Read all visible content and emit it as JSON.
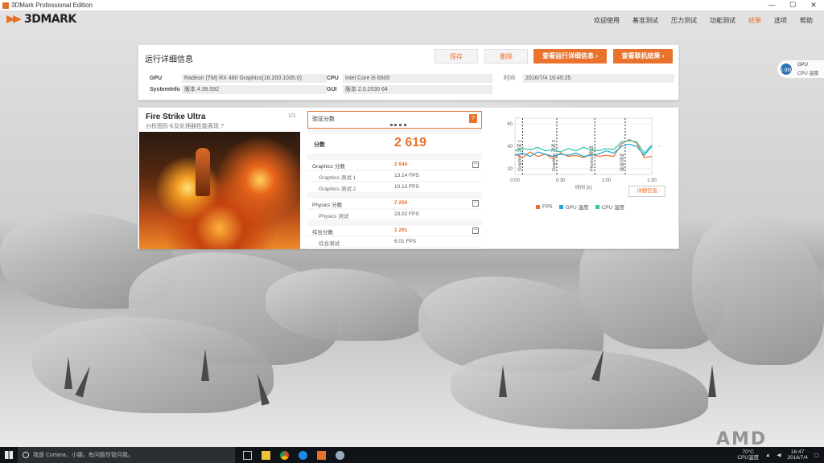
{
  "window": {
    "title": "3DMark Professional Edition",
    "controls": [
      "—",
      "☐",
      "✕"
    ]
  },
  "app": {
    "logo": "3DMARK"
  },
  "nav": {
    "items": [
      "欢迎使用",
      "基准测试",
      "压力测试",
      "功能测试",
      "结果",
      "选项",
      "帮助"
    ],
    "active_index": 4
  },
  "details": {
    "title": "运行详细信息",
    "buttons": {
      "save": "保存",
      "compare": "删除",
      "view_online": "查看运行详细信息 ›",
      "view_results": "查看联机结果 ›"
    },
    "gpu_label": "GPU",
    "gpu_value": "Radeon (TM) RX 480 Graphics(16.200.1035.0)",
    "sysinfo_label": "SystemInfo",
    "sysinfo_value": "版本 4.39.592",
    "cpu_label": "CPU",
    "cpu_value": "Intel Core i5 6500",
    "gui_label": "GUI",
    "gui_value": "版本 2.0.2530 64",
    "time_label": "时间",
    "time_value": "2016/7/4 16:45:25"
  },
  "test": {
    "name": "Fire Strike Ultra",
    "subtitle": "分析图形卡及处理器性能表现 ?",
    "pager": "1/1",
    "valid_label": "验证分数",
    "help": "?",
    "score_label": "分数",
    "score": "2 619",
    "graphics_label": "Graphics 分数",
    "graphics_score": "2 644",
    "gt1_label": "Graphics 测试 1",
    "gt1_value": "13.14 FPS",
    "gt2_label": "Graphics 测试 2",
    "gt2_value": "10.13 FPS",
    "physics_label": "Physics 分数",
    "physics_score": "7 250",
    "pt_label": "Physics 测试",
    "pt_value": "23.02 FPS",
    "combined_label": "综合分数",
    "combined_score": "1 291",
    "ct_label": "综合测试",
    "ct_value": "6.01 FPS",
    "minus": "−",
    "detail_button": "详细信息"
  },
  "chart_data": {
    "type": "line",
    "x": [
      0,
      10,
      20,
      30,
      40,
      50,
      60,
      70,
      80,
      90,
      100,
      110,
      120,
      130,
      140,
      150,
      160,
      170,
      180
    ],
    "series": [
      {
        "name": "FPS",
        "color": "#e9722c",
        "values": [
          33,
          30,
          35,
          31,
          33,
          29,
          34,
          31,
          32,
          30,
          33,
          31,
          32,
          31,
          42,
          46,
          43,
          30,
          31
        ]
      },
      {
        "name": "GPU 温度",
        "color": "#1da5d8",
        "values": [
          32,
          34,
          31,
          35,
          33,
          31,
          33,
          32,
          34,
          31,
          32,
          33,
          36,
          34,
          40,
          42,
          40,
          32,
          40
        ]
      },
      {
        "name": "CPU 温度",
        "color": "#2bc8a8",
        "values": [
          36,
          38,
          37,
          39,
          36,
          37,
          35,
          38,
          36,
          39,
          37,
          36,
          38,
          37,
          44,
          45,
          44,
          34,
          41
        ]
      }
    ],
    "ylim": [
      15,
      65
    ],
    "y_ticks": [
      "60",
      "40",
      "20"
    ],
    "x_ticks": [
      "0:00",
      "0:30",
      "1:00",
      "1:30"
    ],
    "x_tick_values": [
      0,
      60,
      120,
      180
    ],
    "xlabel": "时间 [s]",
    "sections": [
      "Graphics 测试 1",
      "Graphics 测试 2",
      "Physics 测试",
      "综合测试"
    ],
    "section_bounds": [
      10,
      55,
      105,
      145
    ],
    "legend": "bottom"
  },
  "badge": {
    "value": "1.98G",
    "line1": "GPU",
    "line2": "CPU 温度"
  },
  "watermark": "AMD",
  "taskbar": {
    "search_placeholder": "我是 Cortana，小娜。有问题尽管问我。",
    "temp": "70°C",
    "temp_label": "CPU温度",
    "time": "16:47",
    "date": "2016/7/4"
  }
}
